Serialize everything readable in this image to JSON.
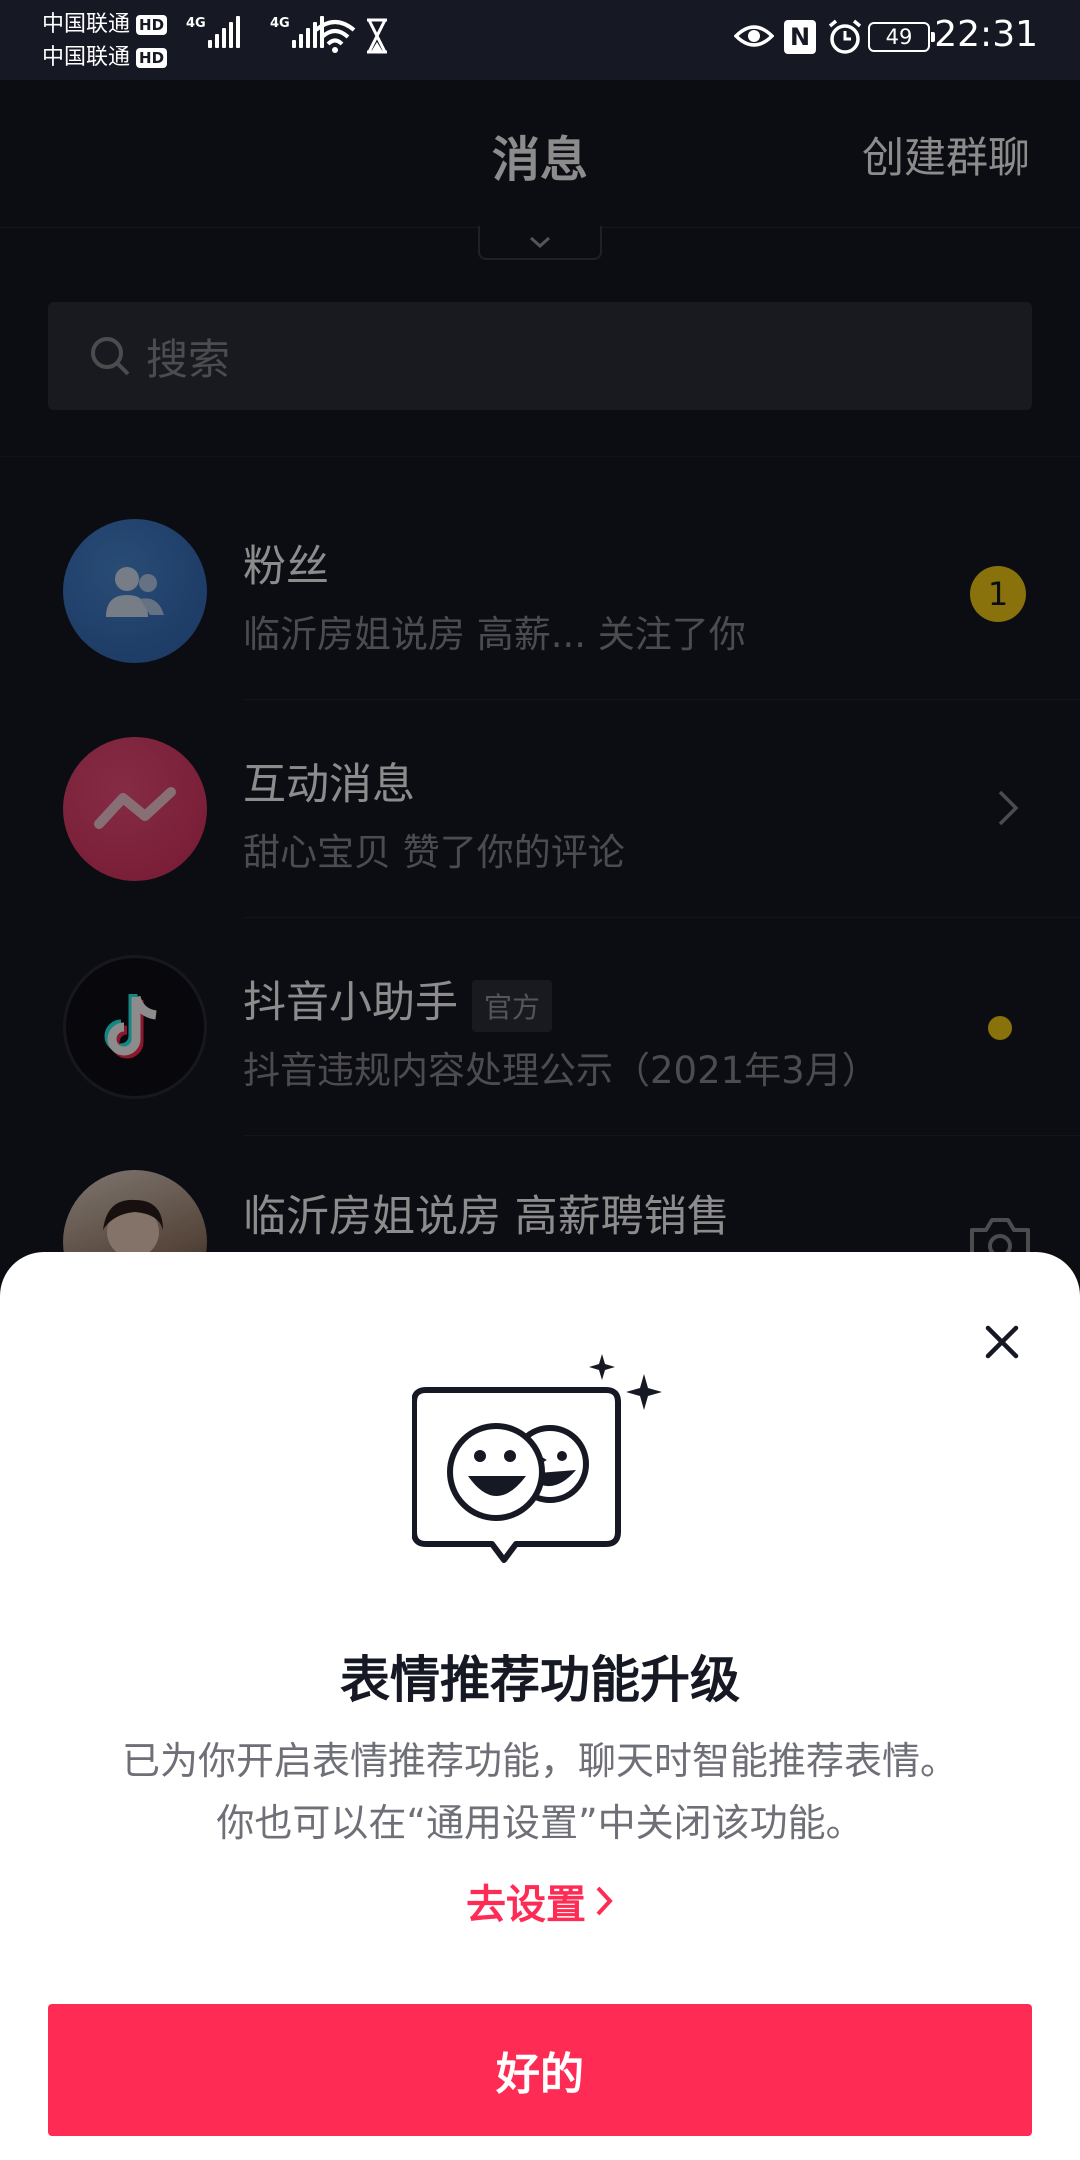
{
  "status_bar": {
    "carrier1": "中国联通",
    "carrier2": "中国联通",
    "hd": "HD",
    "network": "4G",
    "battery": "49",
    "nfc": "N",
    "time": "22:31"
  },
  "header": {
    "title": "消息",
    "create_group": "创建群聊"
  },
  "search": {
    "placeholder": "搜索"
  },
  "messages": [
    {
      "title": "粉丝",
      "subtitle": "临沂房姐说房 高薪... 关注了你",
      "badge": "1",
      "icon": "fans-icon",
      "color": "#3a78c4"
    },
    {
      "title": "互动消息",
      "subtitle": "甜心宝贝 赞了你的评论",
      "icon": "interaction-icon",
      "color": "#e83d6a"
    },
    {
      "title": "抖音小助手",
      "tag": "官方",
      "subtitle": "抖音违规内容处理公示（2021年3月）",
      "icon": "tiktok-logo",
      "color": "#161823"
    },
    {
      "title": "临沂房姐说房 高薪聘销售",
      "icon": "user-avatar",
      "color": "#c9b7a8"
    }
  ],
  "dialog": {
    "title": "表情推荐功能升级",
    "desc_line1": "已为你开启表情推荐功能，聊天时智能推荐表情。",
    "desc_line2": "你也可以在“通用设置”中关闭该功能。",
    "settings_link": "去设置",
    "ok_label": "好的",
    "accent": "#fe2c55"
  }
}
